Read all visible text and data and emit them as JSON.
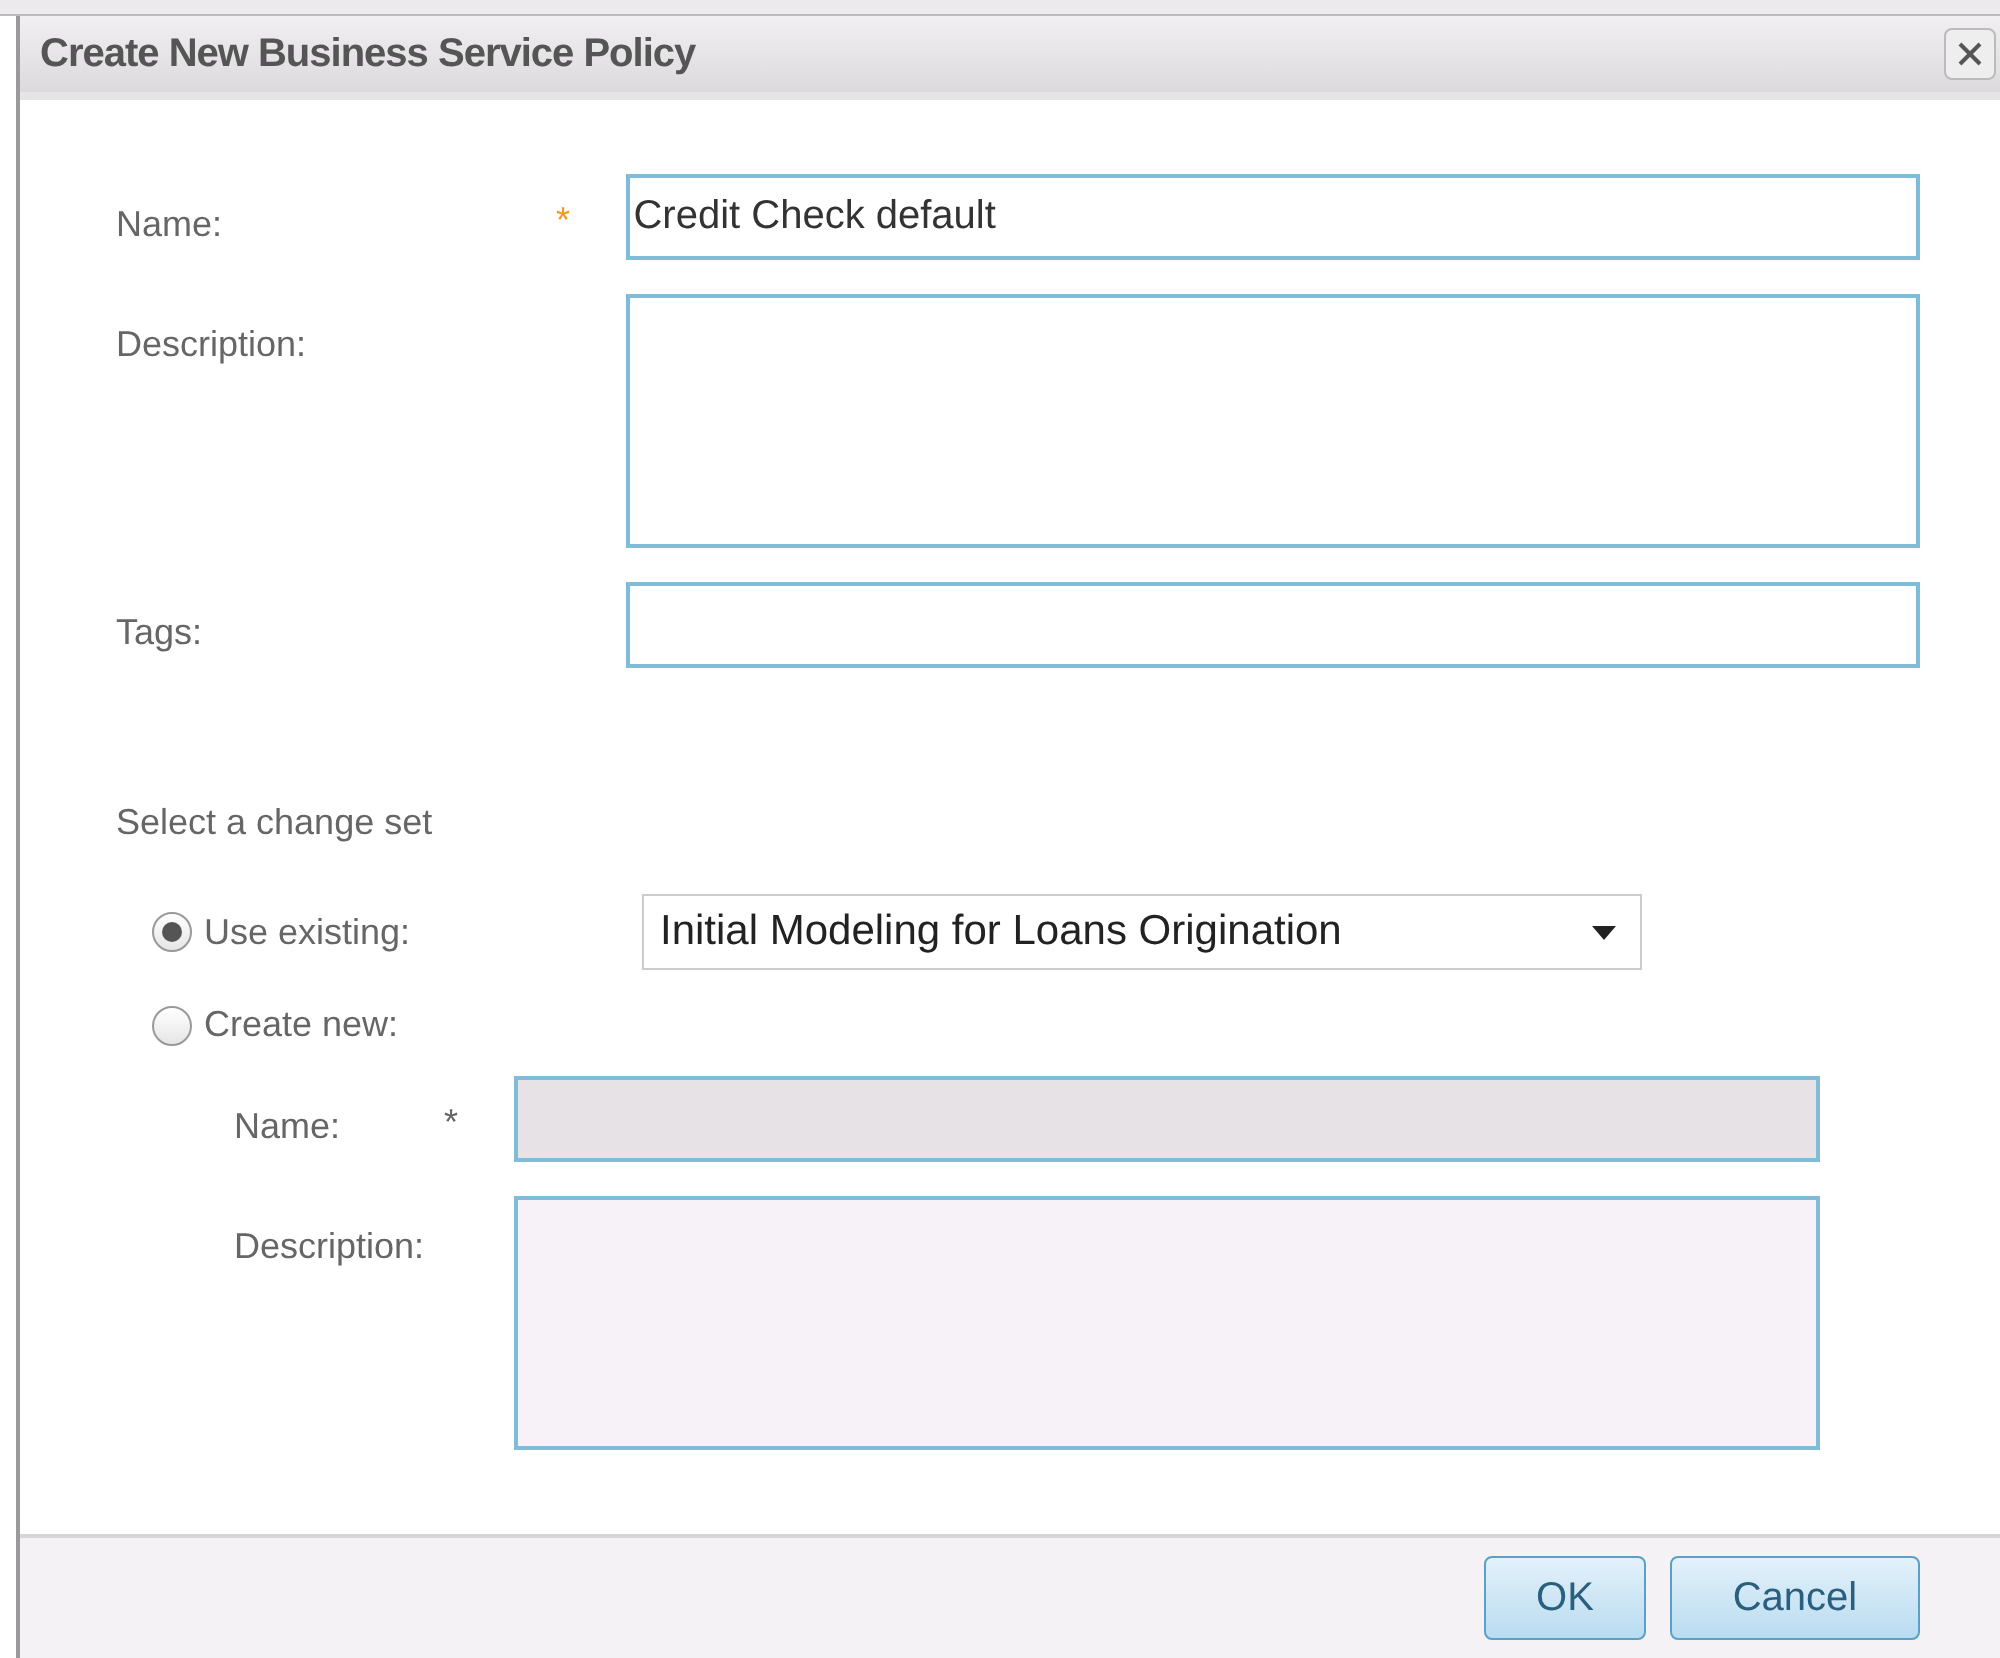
{
  "window": {
    "title": "Create New Business Service Policy"
  },
  "fields": [
    {
      "label": "Name:",
      "required_mark": "*",
      "kind": "line",
      "value": "Credit Check default"
    },
    {
      "label": "Description:",
      "kind": "area"
    },
    {
      "label": "Tags:",
      "kind": "line"
    }
  ],
  "change_set": {
    "heading": "Select a change set",
    "options": [
      {
        "label": "Use existing:",
        "selected": true,
        "select_value": "Initial Modeling for Loans Origination"
      },
      {
        "label": "Create new:",
        "selected": false,
        "fields": [
          {
            "label": "Name:",
            "required_mark": "*",
            "kind": "line",
            "disabled": true
          },
          {
            "label": "Description:",
            "kind": "area"
          }
        ]
      }
    ]
  },
  "buttons": [
    "OK",
    "Cancel"
  ]
}
